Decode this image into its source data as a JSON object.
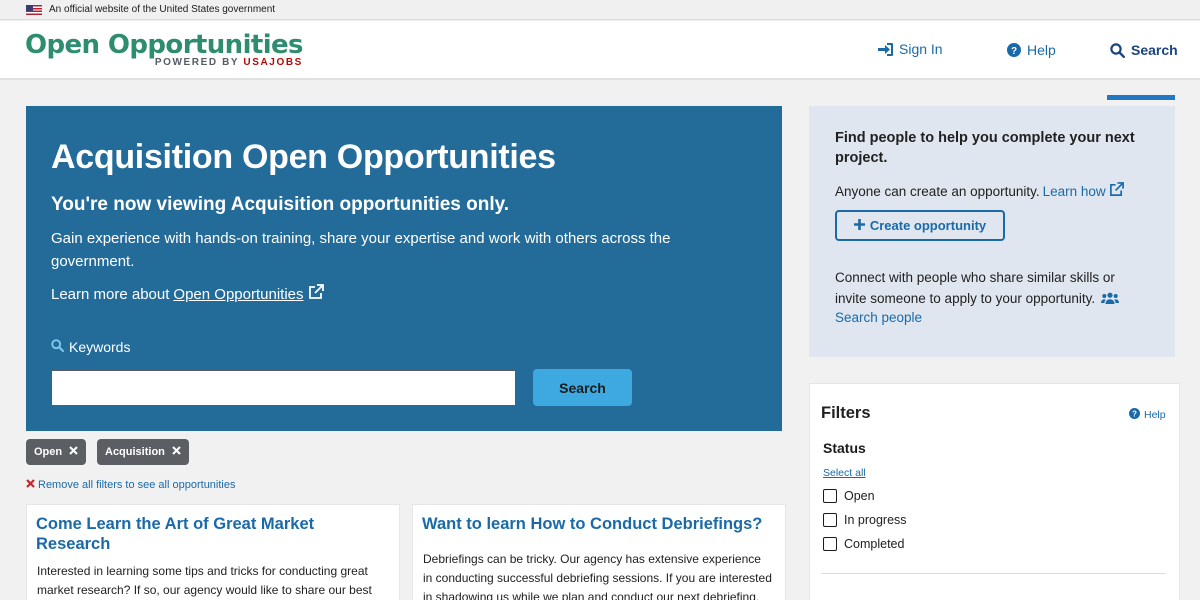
{
  "gov_banner": {
    "text": "An official website of the United States government"
  },
  "header": {
    "logo_title": "Open Opportunities",
    "logo_powered": "POWERED BY",
    "logo_brand": "USAJOBS",
    "nav": {
      "sign_in": "Sign In",
      "help": "Help",
      "search": "Search"
    }
  },
  "hero": {
    "title": "Acquisition Open Opportunities",
    "subtitle": "You're now viewing Acquisition opportunities only.",
    "description": "Gain experience with hands-on training, share your expertise and work with others across the government.",
    "learn_prefix": "Learn more about",
    "learn_link": "Open Opportunities",
    "keywords_label": "Keywords",
    "keywords_value": "",
    "search_button": "Search"
  },
  "chips": [
    {
      "label": "Open"
    },
    {
      "label": "Acquisition"
    }
  ],
  "remove_all": "Remove all filters to see all opportunities",
  "cards": [
    {
      "title": "Come Learn the Art of Great Market Research",
      "body": "Interested in learning some tips and tricks for conducting great market research? If so, our agency would like to share our best"
    },
    {
      "title": "Want to learn How to Conduct Debriefings?",
      "body": "Debriefings can be tricky. Our agency has extensive experience in conducting successful debriefing sessions. If you are interested in shadowing us while we plan and conduct our next debriefing, then"
    }
  ],
  "side": {
    "heading": "Find people to help you complete your next project.",
    "anyone_text": "Anyone can create an opportunity.",
    "learn_how": "Learn how",
    "create_button": "Create opportunity",
    "connect_text": "Connect with people who share similar skills or invite someone to apply to your opportunity.",
    "search_people": "Search people"
  },
  "filters": {
    "title": "Filters",
    "help": "Help",
    "status_title": "Status",
    "select_all": "Select all",
    "options": [
      {
        "label": "Open",
        "checked": false
      },
      {
        "label": "In progress",
        "checked": false
      },
      {
        "label": "Completed",
        "checked": false
      }
    ]
  },
  "colors": {
    "hero_bg": "#236b99",
    "link": "#1a6aa8",
    "brand_green": "#2e8d6f",
    "search_button": "#3da9e0",
    "side_panel_bg": "#dfe6ef"
  }
}
